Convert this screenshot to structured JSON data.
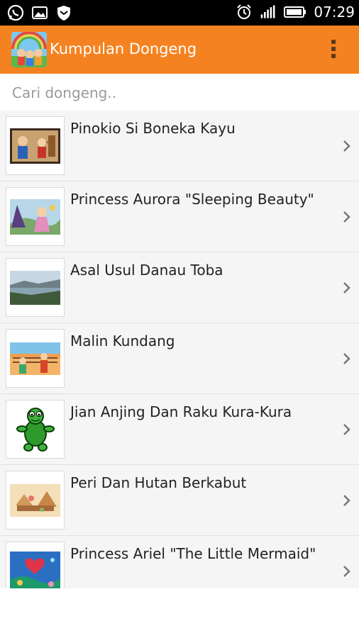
{
  "status_bar": {
    "time": "07:29",
    "icons": [
      "whatsapp-icon",
      "gallery-icon",
      "shield-icon",
      "alarm-icon",
      "signal-icon",
      "battery-icon"
    ]
  },
  "app_bar": {
    "title": "Kumpulan Dongeng",
    "color": "#f58220",
    "menu_icon": "overflow-menu-icon"
  },
  "search": {
    "placeholder": "Cari dongeng.."
  },
  "stories": [
    {
      "title": "Pinokio Si Boneka Kayu",
      "thumb": "pinocchio-illustration"
    },
    {
      "title": "Princess Aurora \"Sleeping Beauty\"",
      "thumb": "aurora-illustration"
    },
    {
      "title": "Asal Usul Danau Toba",
      "thumb": "lake-toba-photo"
    },
    {
      "title": "Malin Kundang",
      "thumb": "malin-kundang-illustration"
    },
    {
      "title": "Jian Anjing Dan Raku Kura-Kura",
      "thumb": "turtle-illustration"
    },
    {
      "title": "Peri Dan Hutan Berkabut",
      "thumb": "fairy-forest-illustration"
    },
    {
      "title": "Princess Ariel \"The Little Mermaid\"",
      "thumb": "ariel-illustration"
    }
  ]
}
